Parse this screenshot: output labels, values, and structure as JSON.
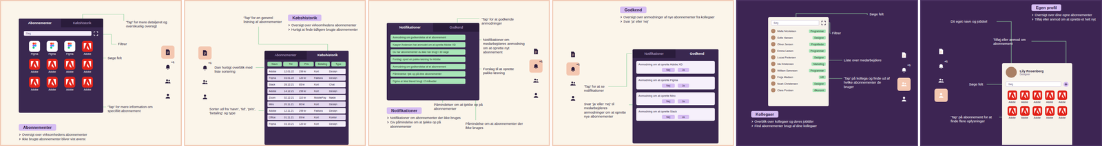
{
  "panels": [
    {
      "kind": "subscriptions",
      "title": "Abonnementer",
      "bullets": [
        "Oversigt over virksomhedens abonnementer",
        "Ikke brugte abonnementer bliver vist øverst"
      ],
      "notes": [
        "'Tap' for mere detaljeret og overskuelig oversigt",
        "Filtrer",
        "Søge felt",
        "'Tap' for mere information om specifikt abonnement"
      ],
      "nav": [
        {
          "selected": true
        },
        {
          "selected": false,
          "badge": "+1"
        },
        {
          "selected": false
        },
        {
          "selected": false
        }
      ],
      "app": {
        "tabs": [
          {
            "label": "Abonnementer",
            "selected": true
          },
          {
            "label": "Købshistorik",
            "selected": false
          }
        ],
        "search": {
          "placeholder": "Søg"
        },
        "apps": [
          {
            "name": "Figma",
            "kind": "figma"
          },
          {
            "name": "Figma",
            "kind": "figma"
          },
          {
            "name": "Figma",
            "kind": "figma"
          },
          {
            "name": "Adobe",
            "kind": "adobe"
          },
          {
            "name": "Adobe",
            "kind": "adobe"
          },
          {
            "name": "Adobe",
            "kind": "adobe"
          },
          {
            "name": "Adobe",
            "kind": "adobe"
          },
          {
            "name": "Adobe",
            "kind": "adobe"
          },
          {
            "name": "Adobe",
            "kind": "adobe"
          },
          {
            "name": "Adobe",
            "kind": "adobe"
          },
          {
            "name": "Adobe",
            "kind": "adobe"
          },
          {
            "name": "Adobe",
            "kind": "adobe"
          }
        ]
      }
    },
    {
      "kind": "history",
      "title": "Købshistorik",
      "bullets": [
        "Oversigt over virksomhedens abonnementer",
        "Hurtigt at finde tidligere brugte abonnementer"
      ],
      "notes": [
        "'Tap' for en generel listning af abonnementer",
        "Dan hurtigt overblik med liste sortering",
        "Sorter ud fra 'navn', 'tid', 'pris', 'betaling' og type"
      ],
      "nav": [
        {
          "selected": true
        },
        {
          "selected": false,
          "badge": "+1"
        },
        {
          "selected": false
        },
        {
          "selected": false
        }
      ],
      "app": {
        "tabs": [
          {
            "label": "Abonnementer",
            "selected": false
          },
          {
            "label": "Købshistorik",
            "selected": true
          }
        ],
        "sort": [
          "Navn",
          "Tid",
          "Pris",
          "Betaling",
          "Type"
        ],
        "rows": [
          [
            "Adobe",
            "12.01.22",
            "299 kr",
            "Kort",
            "Design"
          ],
          [
            "Figma",
            "03.01.22",
            "120 kr",
            "Faktura",
            "Design"
          ],
          [
            "Slack",
            "28.12.21",
            "65 kr",
            "Kort",
            "Chat"
          ],
          [
            "Adobe",
            "14.12.21",
            "299 kr",
            "Kort",
            "Design"
          ],
          [
            "Zoom",
            "02.12.21",
            "110 kr",
            "MobilePay",
            "Møde"
          ],
          [
            "Miro",
            "20.11.21",
            "80 kr",
            "Kort",
            "Design"
          ],
          [
            "Adobe",
            "12.11.21",
            "299 kr",
            "Faktura",
            "Design"
          ],
          [
            "Office",
            "01.11.21",
            "89 kr",
            "Kort",
            "Kontor"
          ],
          [
            "Figma",
            "03.10.21",
            "120 kr",
            "Kort",
            "Design"
          ]
        ]
      }
    },
    {
      "kind": "notifications",
      "title": "Notifikationer",
      "bullets": [
        "Notifikationer om abonnementer der ikke bruges",
        "Giv påmindelse om at tjekke op på abonnementer"
      ],
      "notes": [
        "'Tap' for at godkende anmodninger",
        "Notifikationer om medarbejderes anmodning om at oprette nyt abonnement",
        "Forslag til at oprette pakke-løsning",
        "Påmindelser om at tjekke op på abonnementer",
        "Påmindelse om at abonnementer der ikke bruges"
      ],
      "nav": [
        {
          "selected": false
        },
        {
          "selected": true,
          "badge": "+1"
        },
        {
          "selected": false
        },
        {
          "selected": false
        }
      ],
      "app": {
        "tabs": [
          {
            "label": "Notifikationer",
            "selected": true
          },
          {
            "label": "Godkend",
            "selected": false
          }
        ],
        "items": [
          "Anmodning om godkendelse af et abonnement",
          "Kasper Andersen har anmodet om at oprette Adobe XD",
          "Du har abonnementer du ikke har brugt i 30 dage",
          "Forslag: opret en pakke-løsning for Adobe",
          "Anmodning om godkendelse af et abonnement",
          "Påmindelse: tjek op på dine abonnementer",
          "Figma er ikke blevet brugt i 2 måneder"
        ]
      }
    },
    {
      "kind": "approve",
      "title": "Godkend",
      "bullets": [
        "Oversigt over anmodninger af nye abonnementer fra kollegaer",
        "Svar 'ja' eller 'nej'"
      ],
      "notes": [
        "'Tap' for at se notifikationer",
        "Svar 'ja' eller 'nej' til medarbejderes anmodninger om at oprette nye abonnementer"
      ],
      "nav": [
        {
          "selected": false
        },
        {
          "selected": true,
          "badge": "+1"
        },
        {
          "selected": false
        },
        {
          "selected": false
        }
      ],
      "app": {
        "tabs": [
          {
            "label": "Notifikationer",
            "selected": false
          },
          {
            "label": "Godkend",
            "selected": true
          }
        ],
        "buttons": [
          "Nej",
          "Ja"
        ],
        "requests": [
          "Anmodning om at oprette Adobe XD",
          "Anmodning om at oprette Figma",
          "Anmodning om at oprette Miro",
          "Anmodning om at oprette Slack"
        ]
      }
    },
    {
      "kind": "colleagues",
      "title": "Kollegaer",
      "bullets": [
        "Overblik over kollegaer og deres jobtitler",
        "Find abonnementer brugt af dine kollegaer"
      ],
      "notes": [
        "Søge felt",
        "Filtrer",
        "Liste over medarbejdere",
        "'Tap' på kollega og finde ud af hvilke abonnementer de bruger"
      ],
      "nav": [
        {
          "selected": false
        },
        {
          "selected": false,
          "badge": "+1"
        },
        {
          "selected": true
        },
        {
          "selected": false
        }
      ],
      "app": {
        "search": {
          "placeholder": "Søg"
        },
        "people": [
          {
            "name": "Malte Nicolaisen",
            "job": "Programmør"
          },
          {
            "name": "Sofie Hansen",
            "job": "Designer"
          },
          {
            "name": "Oliver Jensen",
            "job": "Projektleder"
          },
          {
            "name": "Emma Larsen",
            "job": "Programmør"
          },
          {
            "name": "Lucas Pedersen",
            "job": "Designer"
          },
          {
            "name": "Ida Kristensen",
            "job": "Marketing"
          },
          {
            "name": "William Sørensen",
            "job": "Programmør"
          },
          {
            "name": "Freja Madsen",
            "job": "HR"
          },
          {
            "name": "Noah Christensen",
            "job": "Designer"
          },
          {
            "name": "Clara Poulsen",
            "job": "Økonomi"
          }
        ]
      }
    },
    {
      "kind": "profile",
      "title": "Egen profil",
      "bullets": [
        "Oversigt over dine egne abonnementer",
        "Tilføj eller anmod om at oprette et helt nyt"
      ],
      "notes": [
        "Dit eget navn og jobtitel",
        "Tilføj eller anmod om abonnement",
        "Søge felt",
        "'Tap' på abonnement for at finde flere oplysninger"
      ],
      "nav": [
        {
          "selected": false
        },
        {
          "selected": false,
          "badge": "+1"
        },
        {
          "selected": false
        },
        {
          "selected": true
        }
      ],
      "app": {
        "name": "Lily Rosenberg",
        "job": "Designer",
        "search": {
          "placeholder": "Søg"
        },
        "apps": [
          {
            "name": "Adobe",
            "kind": "adobe"
          },
          {
            "name": "Adobe",
            "kind": "adobe"
          },
          {
            "name": "Adobe",
            "kind": "adobe"
          },
          {
            "name": "Adobe",
            "kind": "adobe"
          },
          {
            "name": "Adobe",
            "kind": "adobe"
          },
          {
            "name": "Adobe",
            "kind": "adobe"
          },
          {
            "name": "Adobe",
            "kind": "adobe"
          },
          {
            "name": "Adobe",
            "kind": "adobe"
          },
          {
            "name": "Adobe",
            "kind": "adobe"
          },
          {
            "name": "Adobe",
            "kind": "adobe"
          }
        ]
      }
    }
  ]
}
